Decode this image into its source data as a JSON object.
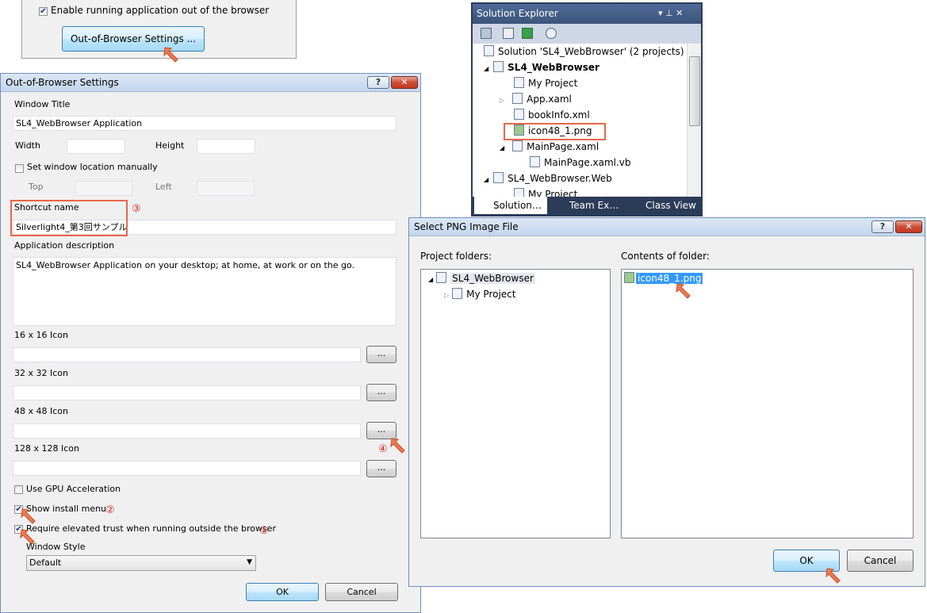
{
  "top_panel": {
    "enable_oob_label": "Enable running application out of the browser",
    "oob_settings_button": "Out-of-Browser Settings ..."
  },
  "oob_dialog": {
    "title": "Out-of-Browser Settings",
    "help_glyph": "?",
    "window_title_label": "Window Title",
    "window_title_value": "SL4_WebBrowser Application",
    "width_label": "Width",
    "height_label": "Height",
    "set_location_label": "Set window location manually",
    "top_label": "Top",
    "left_label": "Left",
    "shortcut_label": "Shortcut name",
    "shortcut_value": "Silverlight4_第3回サンプル",
    "app_desc_label": "Application description",
    "app_desc_value": "SL4_WebBrowser Application on your desktop; at home, at work or on the go.",
    "icon16_label": "16 x 16 Icon",
    "icon32_label": "32 x 32 Icon",
    "icon48_label": "48 x 48 Icon",
    "icon128_label": "128 x 128 Icon",
    "browse_label": "...",
    "gpu_label": "Use GPU Acceleration",
    "install_menu_label": "Show install menu",
    "elevated_label": "Require elevated trust when running outside the browser",
    "window_style_label": "Window Style",
    "window_style_value": "Default",
    "ok": "OK",
    "cancel": "Cancel"
  },
  "annotations": {
    "one": "①",
    "two": "②",
    "three": "③",
    "four": "④"
  },
  "solution_explorer": {
    "title": "Solution Explorer",
    "pin_glyph": "▾ ⊥ ✕",
    "items": [
      {
        "label": "Solution 'SL4_WebBrowser' (2 projects)"
      },
      {
        "label": "SL4_WebBrowser"
      },
      {
        "label": "My Project"
      },
      {
        "label": "App.xaml"
      },
      {
        "label": "bookInfo.xml"
      },
      {
        "label": "icon48_1.png"
      },
      {
        "label": "MainPage.xaml"
      },
      {
        "label": "MainPage.xaml.vb"
      },
      {
        "label": "SL4_WebBrowser.Web"
      },
      {
        "label": "My Project"
      }
    ],
    "tabs": [
      "Solution…",
      "Team Ex…",
      "Class View"
    ]
  },
  "png_dialog": {
    "title": "Select PNG Image File",
    "help_glyph": "?",
    "project_folders_label": "Project folders:",
    "contents_label": "Contents of folder:",
    "tree": [
      {
        "label": "SL4_WebBrowser"
      },
      {
        "label": "My Project"
      }
    ],
    "files": [
      {
        "label": "icon48_1.png"
      }
    ],
    "ok": "OK",
    "cancel": "Cancel"
  }
}
